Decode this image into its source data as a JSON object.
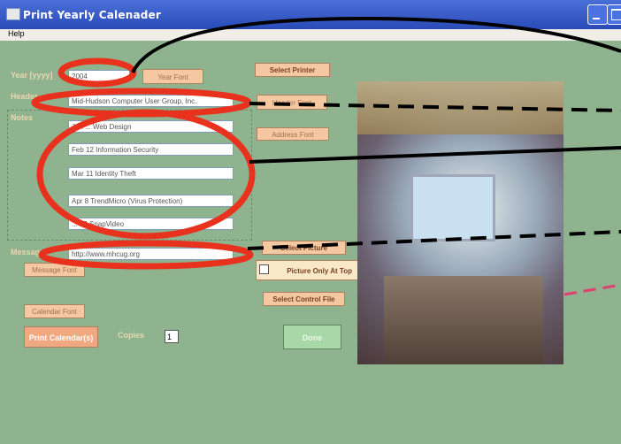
{
  "window": {
    "title": "Print Yearly Calenader"
  },
  "menu": {
    "help": "Help"
  },
  "labels": {
    "year": "Year [yyyy]",
    "header": "Header",
    "notes": "Notes",
    "message": "Message",
    "copies": "Copies"
  },
  "fields": {
    "year": "2004",
    "header": "Mid-Hudson Computer User Group, Inc.",
    "notes": [
      "Jan ... Web Design",
      "Feb 12  Information Security",
      "Mar 11  Identity Theft",
      "Apr 8  TrendMicro (Virus Protection)",
      "... 13  SnapVideo"
    ],
    "message": "http://www.mhcug.org",
    "copies": "1"
  },
  "buttons": {
    "year_font": "Year Font",
    "select_printer": "Select Printer",
    "header_font": "Header Font",
    "address_font": "Address Font",
    "select_picture": "Select Picture",
    "picture_only_at_top": "Picture Only At Top",
    "select_control_file": "Select Control File",
    "message_font": "Message Font",
    "calendar_font": "Calendar Font",
    "print_calendars": "Print Calendar(s)",
    "done": "Done"
  },
  "colors": {
    "form_bg": "#8fb38f",
    "button_bg": "#f4c8a0",
    "title_bar": "#2a4bb8",
    "annotation_red": "#e8321e",
    "annotation_pink": "#e04070"
  }
}
